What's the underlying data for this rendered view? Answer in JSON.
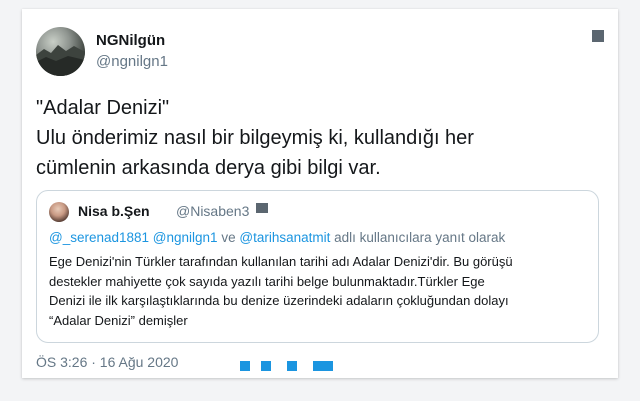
{
  "tweet": {
    "author": {
      "display_name": "NGNilgün",
      "handle": "@ngnilgn1"
    },
    "text_lines": [
      "\"Adalar Denizi\"",
      "Ulu önderimiz nasıl bir bilgeymiş ki, kullandığı her",
      "cümlenin arkasında derya gibi bilgi var."
    ],
    "timestamp": "ÖS 3:26 · 16 Ağu 2020",
    "icons": {
      "more": "more-options-icon",
      "actions": [
        "reply-icon",
        "retweet-icon",
        "like-icon",
        "share-icon"
      ]
    }
  },
  "quote": {
    "author": {
      "display_name": "Nisa b.Şen",
      "handle": "@Nisaben3"
    },
    "reply_context": {
      "mention1": "@_serenad1881",
      "mention2": "@ngnilgn1",
      "connector": "ve",
      "mention3": "@tarihsanatmit",
      "suffix": "adlı kullanıcılara yanıt olarak"
    },
    "text_lines": [
      "Ege Denizi'nin Türkler tarafından kullanılan tarihi adı Adalar Denizi'dir. Bu görüşü",
      "destekler mahiyette çok sayıda yazılı tarihi belge bulunmaktadır.Türkler  Ege",
      "Denizi ile ilk karşılaştıklarında bu denize üzerindeki adaların çokluğundan dolayı",
      "“Adalar Denizi” demişler"
    ]
  },
  "colors": {
    "link_blue": "#1b95e0",
    "muted_gray": "#657786",
    "text": "#14171a",
    "border": "#ccd6dd"
  }
}
